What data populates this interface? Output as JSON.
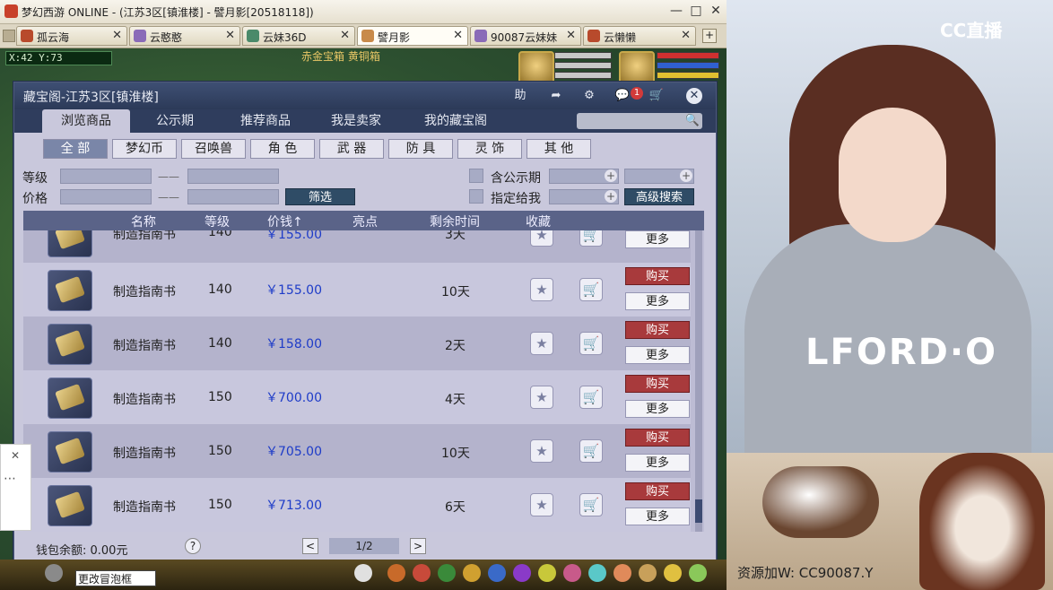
{
  "window": {
    "title": "梦幻西游 ONLINE - (江苏3区[镇淮楼] - 譬月影[20518118])",
    "min": "—",
    "max": "□",
    "close": "✕"
  },
  "tabs": [
    {
      "label": "孤云海",
      "close": "✕",
      "active": false
    },
    {
      "label": "云憨憨",
      "close": "✕",
      "active": false
    },
    {
      "label": "云妹36D",
      "close": "✕",
      "active": false
    },
    {
      "label": "譬月影",
      "close": "✕",
      "active": true
    },
    {
      "label": "90087云妹妹",
      "close": "✕",
      "active": false
    },
    {
      "label": "云懒懒",
      "close": "✕",
      "active": false
    }
  ],
  "tab_add": "+",
  "game": {
    "coords": "X:42 Y:73",
    "top_text": "赤金宝箱   黄铜箱"
  },
  "dialog": {
    "title": "藏宝阁-江苏3区[镇淮楼]",
    "header_buttons": {
      "help": "助",
      "share": "➦",
      "settings": "⚙",
      "chat": "💬",
      "cart": "🛒"
    },
    "notif_count": "1",
    "close": "✕",
    "nav_tabs": [
      "浏览商品",
      "公示期",
      "推荐商品",
      "我是卖家",
      "我的藏宝阁"
    ],
    "active_nav": 0,
    "search_icon": "🔍",
    "categories": [
      "全 部",
      "梦幻币",
      "召唤兽",
      "角 色",
      "武 器",
      "防 具",
      "灵 饰",
      "其 他"
    ],
    "active_category": 0,
    "filters": {
      "level_label": "等级",
      "price_label": "价格",
      "dash": "——",
      "filter_button": "筛选",
      "public_label": "含公示期",
      "assign_label": "指定给我",
      "advanced_button": "高级搜索",
      "plus": "+"
    },
    "table": {
      "headers": [
        "名称",
        "等级",
        "价钱↑",
        "亮点",
        "剩余时间",
        "收藏"
      ],
      "partial_row": {
        "name": "制造指南书",
        "level": "140",
        "price": "￥155.00",
        "time": "3天",
        "more": "更多"
      },
      "rows": [
        {
          "name": "制造指南书",
          "level": "140",
          "price": "￥155.00",
          "time": "10天",
          "buy": "购买",
          "more": "更多"
        },
        {
          "name": "制造指南书",
          "level": "140",
          "price": "￥158.00",
          "time": "2天",
          "buy": "购买",
          "more": "更多"
        },
        {
          "name": "制造指南书",
          "level": "150",
          "price": "￥700.00",
          "time": "4天",
          "buy": "购买",
          "more": "更多"
        },
        {
          "name": "制造指南书",
          "level": "150",
          "price": "￥705.00",
          "time": "10天",
          "buy": "购买",
          "more": "更多"
        },
        {
          "name": "制造指南书",
          "level": "150",
          "price": "￥713.00",
          "time": "6天",
          "buy": "购买",
          "more": "更多"
        }
      ],
      "star_icon": "★",
      "cart_icon": "🛒"
    },
    "footer": {
      "wallet": "钱包余额: 0.00元",
      "help": "?",
      "prev": "<",
      "page": "1/2",
      "next": ">"
    }
  },
  "bottom": {
    "bubble": "更改冒泡框"
  },
  "side_panel": {
    "close": "✕",
    "more": "⋯"
  },
  "stream": {
    "logo": "CC直播",
    "shirt_print": "LFORD·O",
    "resource_text": "资源加W: CC90087.Y"
  }
}
